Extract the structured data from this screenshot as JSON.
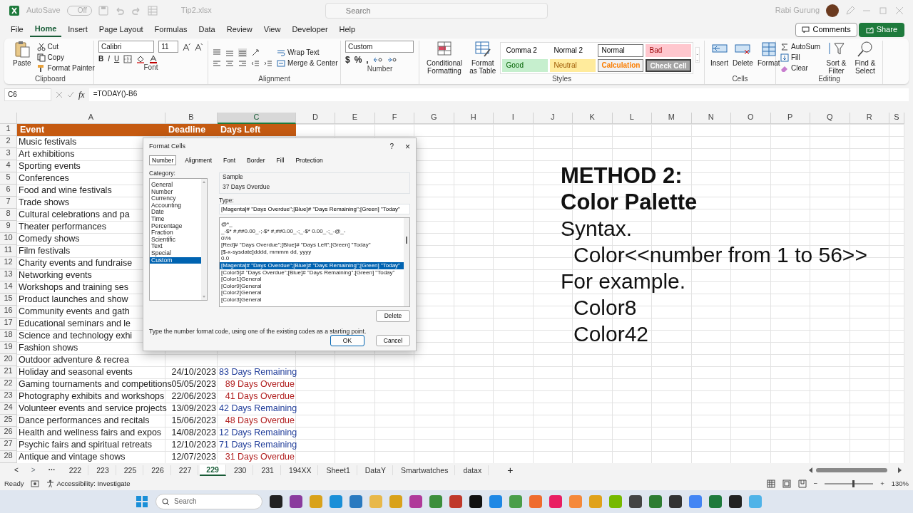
{
  "title_bar": {
    "autosave_label": "AutoSave",
    "autosave_toggle": "Off",
    "autosave_on": false,
    "file_name": "Tip2.xlsx",
    "search_placeholder": "Search",
    "user_name": "Rabi Gurung"
  },
  "menu_tabs": [
    {
      "label": "File",
      "selected": false
    },
    {
      "label": "Home",
      "selected": true
    },
    {
      "label": "Insert",
      "selected": false
    },
    {
      "label": "Page Layout",
      "selected": false
    },
    {
      "label": "Formulas",
      "selected": false
    },
    {
      "label": "Data",
      "selected": false
    },
    {
      "label": "Review",
      "selected": false
    },
    {
      "label": "View",
      "selected": false
    },
    {
      "label": "Developer",
      "selected": false
    },
    {
      "label": "Help",
      "selected": false
    }
  ],
  "menu_buttons": {
    "comments": "Comments",
    "share": "Share"
  },
  "ribbon": {
    "clipboard": {
      "label": "Clipboard",
      "paste": "Paste",
      "cut": "Cut",
      "copy": "Copy",
      "format_painter": "Format Painter"
    },
    "font": {
      "label": "Font",
      "font_name": "Calibri",
      "font_size": "11",
      "bold": "B",
      "italic": "I",
      "underline": "U"
    },
    "alignment": {
      "label": "Alignment",
      "wrap_text": "Wrap Text",
      "merge": "Merge & Center"
    },
    "number": {
      "label": "Number",
      "format": "Custom",
      "currency": "$",
      "percent": "%",
      "comma": ","
    },
    "styles": {
      "label": "Styles",
      "conditional": "Conditional Formatting",
      "format_table": "Format as Table",
      "cell_styles": [
        {
          "label": "Comma 2",
          "kind": "plain"
        },
        {
          "label": "Normal 2",
          "kind": "plain"
        },
        {
          "label": "Normal",
          "kind": "normal"
        },
        {
          "label": "Bad",
          "kind": "bad"
        },
        {
          "label": "Good",
          "kind": "good"
        },
        {
          "label": "Neutral",
          "kind": "neutral"
        },
        {
          "label": "Calculation",
          "kind": "calculation"
        },
        {
          "label": "Check Cell",
          "kind": "check"
        }
      ]
    },
    "cells": {
      "label": "Cells",
      "buttons": [
        "Insert",
        "Delete",
        "Format"
      ]
    },
    "editing": {
      "label": "Editing",
      "autosum": "AutoSum",
      "fill": "Fill",
      "clear": "Clear",
      "sort": "Sort & Filter",
      "find": "Find & Select"
    }
  },
  "formula_bar": {
    "name_box": "C6",
    "fx": "fx",
    "formula": "=TODAY()-B6"
  },
  "columns": [
    {
      "label": "A",
      "selected": false
    },
    {
      "label": "B",
      "selected": false
    },
    {
      "label": "C",
      "selected": true
    },
    {
      "label": "D",
      "selected": false
    },
    {
      "label": "E",
      "selected": false
    },
    {
      "label": "F",
      "selected": false
    },
    {
      "label": "G",
      "selected": false
    },
    {
      "label": "H",
      "selected": false
    },
    {
      "label": "I",
      "selected": false
    },
    {
      "label": "J",
      "selected": false
    },
    {
      "label": "K",
      "selected": false
    },
    {
      "label": "L",
      "selected": false
    },
    {
      "label": "M",
      "selected": false
    },
    {
      "label": "N",
      "selected": false
    },
    {
      "label": "O",
      "selected": false
    },
    {
      "label": "P",
      "selected": false
    },
    {
      "label": "Q",
      "selected": false
    },
    {
      "label": "R",
      "selected": false
    },
    {
      "label": "S",
      "selected": false
    }
  ],
  "rows": [
    {
      "number": "1",
      "kind": "header",
      "event": "Event",
      "deadline": "Deadline",
      "days_left": "Days Left"
    },
    {
      "number": "2",
      "kind": "data",
      "event": "Music festivals"
    },
    {
      "number": "3",
      "kind": "data",
      "event": "Art exhibitions"
    },
    {
      "number": "4",
      "kind": "data",
      "event": "Sporting events"
    },
    {
      "number": "5",
      "kind": "data",
      "event": "Conferences"
    },
    {
      "number": "6",
      "kind": "data",
      "event": "Food and wine festivals"
    },
    {
      "number": "7",
      "kind": "data",
      "event": "Trade shows"
    },
    {
      "number": "8",
      "kind": "data",
      "event": "Cultural celebrations and pa"
    },
    {
      "number": "9",
      "kind": "data",
      "event": "Theater performances"
    },
    {
      "number": "10",
      "kind": "data",
      "event": "Comedy shows"
    },
    {
      "number": "11",
      "kind": "data",
      "event": "Film festivals"
    },
    {
      "number": "12",
      "kind": "data",
      "event": "Charity events and fundraise"
    },
    {
      "number": "13",
      "kind": "data",
      "event": "Networking events"
    },
    {
      "number": "14",
      "kind": "data",
      "event": "Workshops and training ses"
    },
    {
      "number": "15",
      "kind": "data",
      "event": "Product launches and show"
    },
    {
      "number": "16",
      "kind": "data",
      "event": "Community events and gath"
    },
    {
      "number": "17",
      "kind": "data",
      "event": "Educational seminars and le"
    },
    {
      "number": "18",
      "kind": "data",
      "event": "Science and technology exhi"
    },
    {
      "number": "19",
      "kind": "data",
      "event": "Fashion shows"
    },
    {
      "number": "20",
      "kind": "data",
      "event": "Outdoor adventure & recrea"
    },
    {
      "number": "21",
      "kind": "data",
      "event": "Holiday and seasonal events",
      "deadline": "24/10/2023",
      "days_left": "83 Days Remaining",
      "color": "#1f3c99"
    },
    {
      "number": "22",
      "kind": "data",
      "event": "Gaming tournaments and competitions",
      "deadline": "05/05/2023",
      "days_left": "89 Days Overdue",
      "color": "#b22222"
    },
    {
      "number": "23",
      "kind": "data",
      "event": "Photography exhibits and workshops",
      "deadline": "22/06/2023",
      "days_left": "41 Days Overdue",
      "color": "#b22222"
    },
    {
      "number": "24",
      "kind": "data",
      "event": "Volunteer events and service projects",
      "deadline": "13/09/2023",
      "days_left": "42 Days Remaining",
      "color": "#1f3c99"
    },
    {
      "number": "25",
      "kind": "data",
      "event": "Dance performances and recitals",
      "deadline": "15/06/2023",
      "days_left": "48 Days Overdue",
      "color": "#b22222"
    },
    {
      "number": "26",
      "kind": "data",
      "event": "Health and wellness fairs and expos",
      "deadline": "14/08/2023",
      "days_left": "12 Days Remaining",
      "color": "#1f3c99"
    },
    {
      "number": "27",
      "kind": "data",
      "event": "Psychic fairs and spiritual retreats",
      "deadline": "12/10/2023",
      "days_left": "71 Days Remaining",
      "color": "#1f3c99"
    },
    {
      "number": "28",
      "kind": "data",
      "event": "Antique and vintage shows",
      "deadline": "12/07/2023",
      "days_left": "31 Days Overdue",
      "color": "#b22222"
    }
  ],
  "dialog": {
    "title": "Format Cells",
    "help": "?",
    "close": "×",
    "tabs": [
      {
        "label": "Number",
        "selected": true
      },
      {
        "label": "Alignment",
        "selected": false
      },
      {
        "label": "Font",
        "selected": false
      },
      {
        "label": "Border",
        "selected": false
      },
      {
        "label": "Fill",
        "selected": false
      },
      {
        "label": "Protection",
        "selected": false
      }
    ],
    "category_label": "Category:",
    "categories": [
      {
        "label": "General",
        "selected": false
      },
      {
        "label": "Number",
        "selected": false
      },
      {
        "label": "Currency",
        "selected": false
      },
      {
        "label": "Accounting",
        "selected": false
      },
      {
        "label": "Date",
        "selected": false
      },
      {
        "label": "Time",
        "selected": false
      },
      {
        "label": "Percentage",
        "selected": false
      },
      {
        "label": "Fraction",
        "selected": false
      },
      {
        "label": "Scientific",
        "selected": false
      },
      {
        "label": "Text",
        "selected": false
      },
      {
        "label": "Special",
        "selected": false
      },
      {
        "label": "Custom",
        "selected": true
      }
    ],
    "sample_label": "Sample",
    "sample_value": "37 Days Overdue",
    "type_label": "Type:",
    "type_value": "[Magenta]# \"Days Overdue\";[Blue]# \"Days Remaining\";[Green] \"Today\"",
    "type_options": [
      {
        "label": "@*_",
        "selected": false
      },
      {
        "label": "_-$* #,##0.00_-;-$* #,##0.00_-;_-$* 0.00_-;_-@_-",
        "selected": false
      },
      {
        "label": "0\\%",
        "selected": false
      },
      {
        "label": "[Red]# \"Days Overdue\";[Blue]# \"Days Left\";[Green] \"Today\"",
        "selected": false
      },
      {
        "label": "[$-x-sysdate]dddd, mmmm dd, yyyy",
        "selected": false
      },
      {
        "label": "0.0",
        "selected": false
      },
      {
        "label": "[Magenta]# \"Days Overdue\";[Blue]# \"Days Remaining\";[Green] \"Today\"",
        "selected": true
      },
      {
        "label": "[Color5]# \"Days Overdue\";[Blue]# \"Days Remaining\";[Green] \"Today\"",
        "selected": false
      },
      {
        "label": "[Color1]General",
        "selected": false
      },
      {
        "label": "[Color9]General",
        "selected": false
      },
      {
        "label": "[Color2]General",
        "selected": false
      },
      {
        "label": "[Color3]General",
        "selected": false
      }
    ],
    "delete": "Delete",
    "hint": "Type the number format code, using one of the existing codes as a starting point.",
    "ok": "OK",
    "cancel": "Cancel"
  },
  "note": [
    {
      "text": "METHOD 2:",
      "kind": "heading"
    },
    {
      "text": "Color Palette",
      "kind": "heading"
    },
    {
      "text": "Syntax.",
      "kind": "plain"
    },
    {
      "text": "Color<<number from 1 to 56>>",
      "kind": "indent"
    },
    {
      "text": "For example.",
      "kind": "plain"
    },
    {
      "text": "Color8",
      "kind": "indent"
    },
    {
      "text": "Color42",
      "kind": "indent"
    }
  ],
  "sheet_tabs": {
    "prev": "<",
    "next": ">",
    "more": "···",
    "add": "+",
    "tabs": [
      {
        "label": "222",
        "selected": false
      },
      {
        "label": "223",
        "selected": false
      },
      {
        "label": "225",
        "selected": false
      },
      {
        "label": "226",
        "selected": false
      },
      {
        "label": "227",
        "selected": false
      },
      {
        "label": "229",
        "selected": true
      },
      {
        "label": "230",
        "selected": false
      },
      {
        "label": "231",
        "selected": false
      },
      {
        "label": "194XX",
        "selected": false
      },
      {
        "label": "Sheet1",
        "selected": false
      },
      {
        "label": "DataY",
        "selected": false
      },
      {
        "label": "Smartwatches",
        "selected": false
      },
      {
        "label": "datax",
        "selected": false
      }
    ]
  },
  "status_bar": {
    "ready": "Ready",
    "accessibility": "Accessibility: Investigate",
    "zoom_minus": "−",
    "zoom_plus": "+",
    "zoom_slider": {
      "level": 0.57
    },
    "zoom": "130%"
  },
  "taskbar": {
    "search_placeholder": "Search"
  }
}
